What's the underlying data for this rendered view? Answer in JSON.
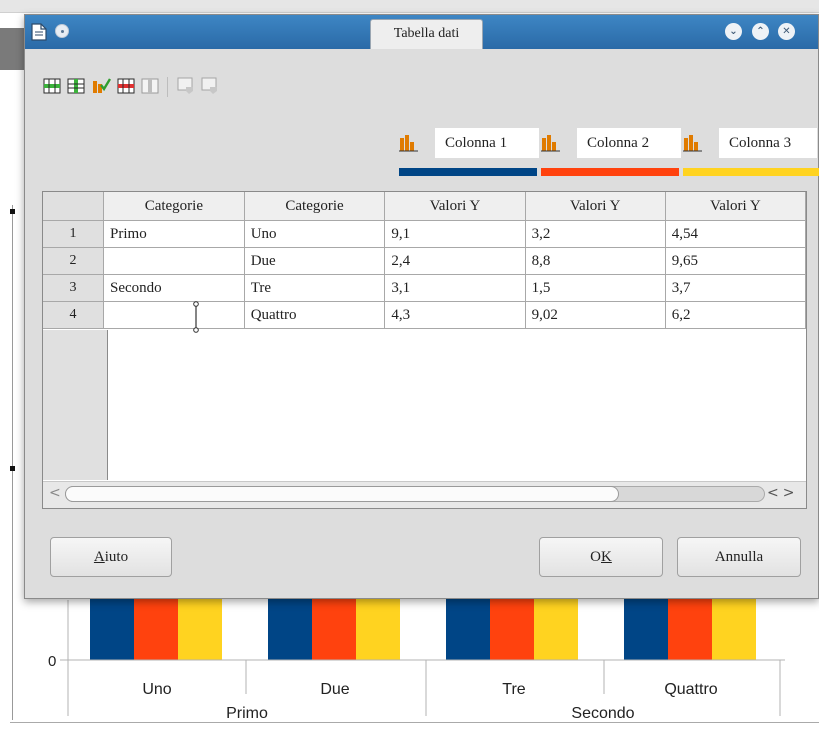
{
  "dialog": {
    "title": "Tabella dati",
    "window_buttons": [
      "minimize",
      "maximize",
      "close"
    ]
  },
  "toolbar": {
    "icons": [
      "insert-row-icon",
      "insert-column-icon",
      "insert-text-column-icon",
      "delete-row-icon",
      "delete-column-icon",
      "move-row-down-icon",
      "move-column-right-icon"
    ]
  },
  "series": [
    {
      "name": "Colonna 1",
      "color": "#004586"
    },
    {
      "name": "Colonna 2",
      "color": "#ff420e"
    },
    {
      "name": "Colonna 3",
      "color": "#ffd320"
    }
  ],
  "table": {
    "headers": [
      "Categorie",
      "Categorie",
      "Valori Y",
      "Valori Y",
      "Valori Y"
    ],
    "rows": [
      {
        "num": "1",
        "cells": [
          "Primo",
          "Uno",
          "9,1",
          "3,2",
          "4,54"
        ]
      },
      {
        "num": "2",
        "cells": [
          "",
          "Due",
          "2,4",
          "8,8",
          "9,65"
        ]
      },
      {
        "num": "3",
        "cells": [
          "Secondo",
          "Tre",
          "3,1",
          "1,5",
          "3,7"
        ]
      },
      {
        "num": "4",
        "cells": [
          "",
          "Quattro",
          "4,3",
          "9,02",
          "6,2"
        ]
      }
    ]
  },
  "buttons": {
    "help_pre": "",
    "help_mnemonic": "A",
    "help_post": "iuto",
    "ok_pre": "O",
    "ok_mnemonic": "K",
    "ok_post": "",
    "cancel": "Annulla"
  },
  "background_chart": {
    "y_tick": "0",
    "categories": [
      "Uno",
      "Due",
      "Tre",
      "Quattro"
    ],
    "groups": [
      "Primo",
      "Secondo"
    ]
  }
}
